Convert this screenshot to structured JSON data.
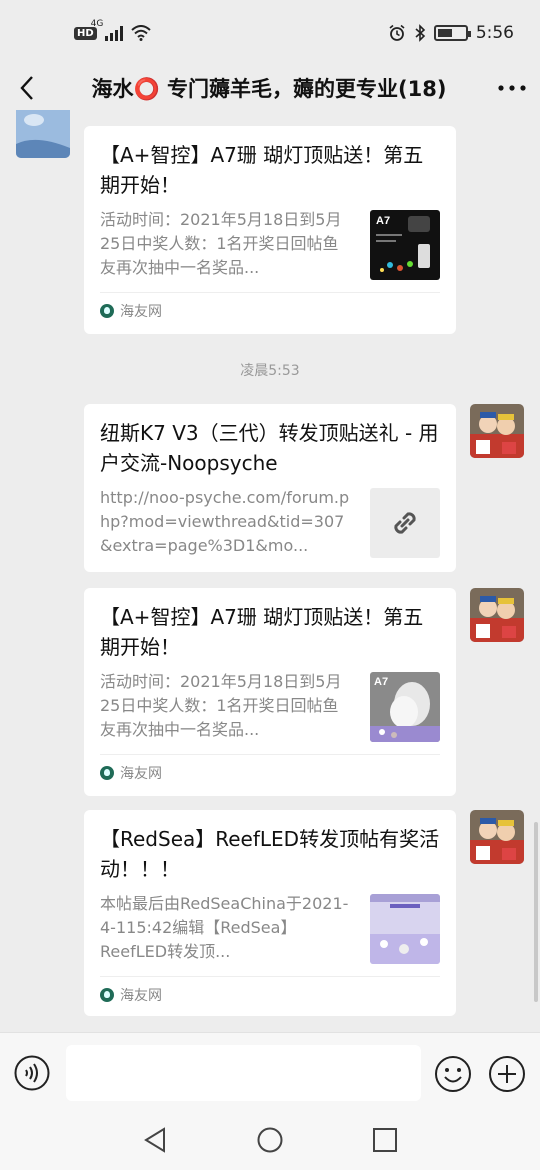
{
  "status_bar": {
    "network": "4G",
    "hd": "HD",
    "time": "5:56"
  },
  "header": {
    "title": "海水⭕ 专门薅羊毛，薅的更专业(18)"
  },
  "messages": [
    {
      "title": "【A+智控】A7珊 瑚灯顶贴送！第五期开始！",
      "desc": "活动时间：2021年5月18日到5月25日中奖人数：1名开奖日回帖鱼友再次抽中一名奖品...",
      "source": "海友网",
      "thumb_label": "A7"
    },
    {
      "title": "纽斯K7 V3（三代）转发顶贴送礼 - 用户交流-Noopsyche",
      "desc": "http://noo-psyche.com/forum.php?mod=viewthread&tid=307&extra=page%3D1&mo..."
    },
    {
      "title": "【A+智控】A7珊 瑚灯顶贴送！第五期开始！",
      "desc": "活动时间：2021年5月18日到5月25日中奖人数：1名开奖日回帖鱼友再次抽中一名奖品...",
      "source": "海友网",
      "thumb_label": "A7"
    },
    {
      "title": "【RedSea】ReefLED转发顶帖有奖活动！！！",
      "desc": "本帖最后由RedSeaChina于2021-4-115:42编辑【RedSea】ReefLED转发顶...",
      "source": "海友网"
    }
  ],
  "timestamp": "凌晨5:53",
  "input": {
    "placeholder": ""
  }
}
